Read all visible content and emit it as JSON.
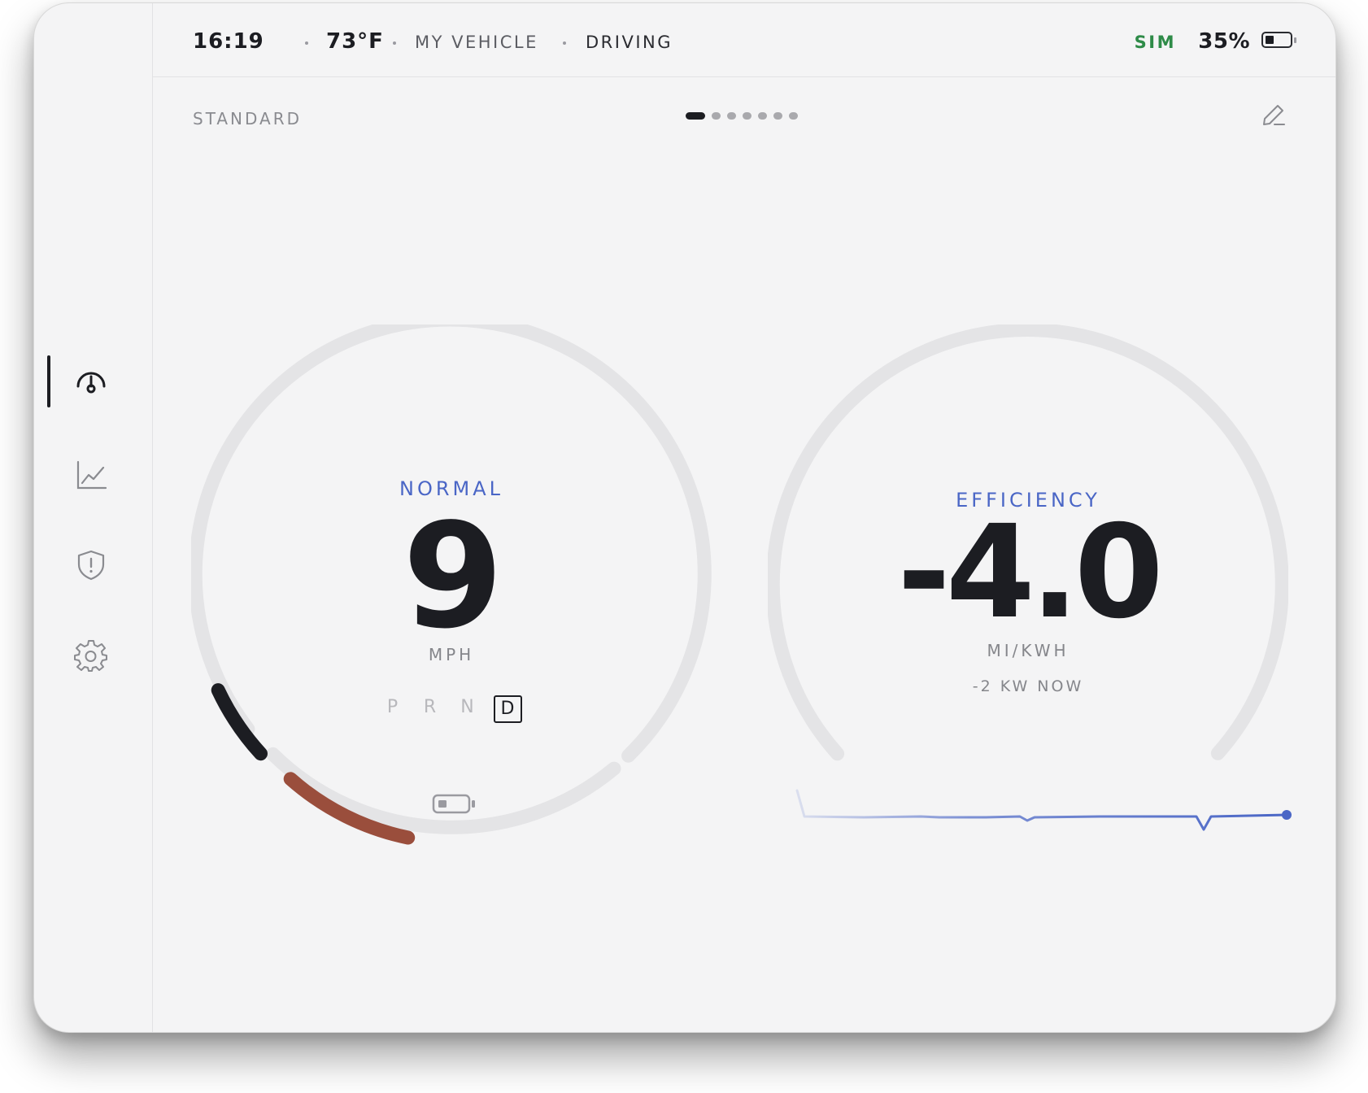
{
  "status_bar": {
    "time": "16:19",
    "temperature": "73°F",
    "vehicle_name": "MY VEHICLE",
    "vehicle_state": "DRIVING",
    "sim_label": "SIM",
    "battery_percent": "35%",
    "battery_level": 0.35,
    "sim_color": "#2e8b48"
  },
  "sidebar": {
    "items": [
      {
        "icon": "gauge-icon",
        "active": true
      },
      {
        "icon": "chart-icon",
        "active": false
      },
      {
        "icon": "shield-alert-icon",
        "active": false
      },
      {
        "icon": "gear-icon",
        "active": false
      }
    ]
  },
  "layout": {
    "name": "STANDARD",
    "page_count": 7,
    "active_page": 1,
    "edit_icon": "pencil-icon"
  },
  "speed_gauge": {
    "mode": "NORMAL",
    "value": "9",
    "unit": "MPH",
    "gears": [
      "P",
      "R",
      "N",
      "D"
    ],
    "active_gear": "D",
    "battery_icon": "battery-icon",
    "colors": {
      "accent": "#4a66c6",
      "speed_arc": "#1c1d22",
      "regen_arc": "#9a4e3c",
      "track": "#e4e4e6"
    }
  },
  "efficiency_gauge": {
    "label": "EFFICIENCY",
    "value": "-4.0",
    "unit": "MI/KWH",
    "power_now": "-2 KW NOW",
    "sparkline_color": "#4a66c6"
  }
}
